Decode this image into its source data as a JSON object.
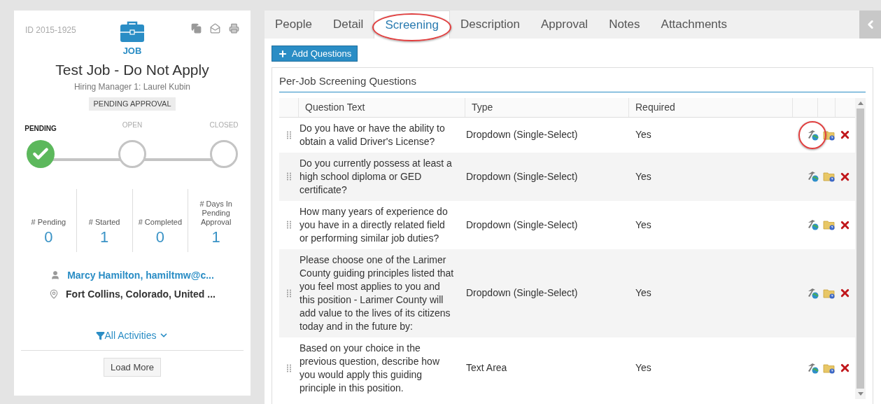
{
  "job_card": {
    "id": "ID 2015-1925",
    "type_label": "JOB",
    "title": "Test Job - Do Not Apply",
    "subtitle": "Hiring Manager 1: Laurel Kubin",
    "status_badge": "PENDING APPROVAL",
    "steps": [
      {
        "label": "PENDING",
        "completed": true
      },
      {
        "label": "OPEN",
        "completed": false
      },
      {
        "label": "CLOSED",
        "completed": false
      }
    ],
    "stats": [
      {
        "label": "# Pending",
        "value": "0"
      },
      {
        "label": "# Started",
        "value": "1"
      },
      {
        "label": "# Completed",
        "value": "0"
      },
      {
        "label": "# Days In Pending Approval",
        "value": "1"
      }
    ],
    "contact": "Marcy Hamilton, hamiltmw@c...",
    "location": "Fort Collins, Colorado, United ...",
    "activity_filter": "All Activities",
    "load_more": "Load More"
  },
  "tabs": [
    {
      "label": "People",
      "selected": false,
      "highlighted": false
    },
    {
      "label": "Detail",
      "selected": false,
      "highlighted": false
    },
    {
      "label": "Screening",
      "selected": true,
      "highlighted": true
    },
    {
      "label": "Description",
      "selected": false,
      "highlighted": false
    },
    {
      "label": "Approval",
      "selected": false,
      "highlighted": false
    },
    {
      "label": "Notes",
      "selected": false,
      "highlighted": false
    },
    {
      "label": "Attachments",
      "selected": false,
      "highlighted": false
    }
  ],
  "add_button": "Add Questions",
  "section_title": "Per-Job Screening Questions",
  "table": {
    "columns": [
      "Question Text",
      "Type",
      "Required"
    ],
    "rows": [
      {
        "question": "Do you have or have the ability to obtain a valid Driver's License?",
        "type": "Dropdown (Single-Select)",
        "required": "Yes",
        "highlighted": true
      },
      {
        "question": "Do you currently possess at least a high school diploma or GED certificate?",
        "type": "Dropdown (Single-Select)",
        "required": "Yes",
        "highlighted": false
      },
      {
        "question": "How many years of experience do you have in a directly related field or performing similar job duties?",
        "type": "Dropdown (Single-Select)",
        "required": "Yes",
        "highlighted": false
      },
      {
        "question": "Please choose one of the Larimer County guiding principles listed that you feel most applies to you and this position - Larimer County will add value to the lives of its citizens today and in the future by:",
        "type": "Dropdown (Single-Select)",
        "required": "Yes",
        "highlighted": false
      },
      {
        "question": "Based on your choice in the previous question, describe how you would apply this guiding principle in this position.",
        "type": "Text Area",
        "required": "Yes",
        "highlighted": false
      }
    ]
  }
}
